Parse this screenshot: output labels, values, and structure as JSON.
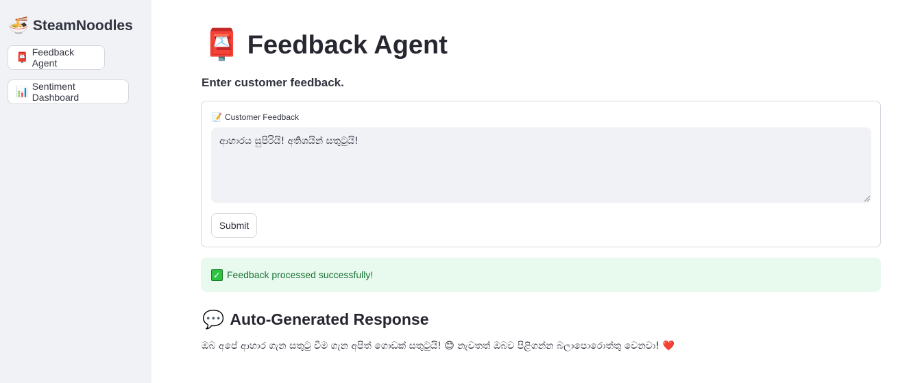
{
  "sidebar": {
    "brand": {
      "icon": "🍜",
      "name": "SteamNoodles"
    },
    "items": [
      {
        "icon": "📮",
        "label": "Feedback Agent"
      },
      {
        "icon": "📊",
        "label": "Sentiment Dashboard"
      }
    ]
  },
  "main": {
    "title": {
      "icon": "📮",
      "text": "Feedback Agent"
    },
    "subtitle": "Enter customer feedback.",
    "form": {
      "field_icon": "📝",
      "field_label": "Customer Feedback",
      "feedback_value": "ආහාරය සුපිරියි! අතිශයින් සතුටුයි!",
      "submit_label": "Submit"
    },
    "success": {
      "icon": "✓",
      "message": "Feedback processed successfully!"
    },
    "response": {
      "icon": "💬",
      "heading": "Auto-Generated Response",
      "text": "ඔබ අපේ ආහාර ගැන සතුටු වීම ගැන අපිත් ගොඩක් සතුටුයි! 😊 නැවතත් ඔබව පිළිගන්න බලාපොරොත්තු වෙනවා! ❤️"
    }
  },
  "colors": {
    "sidebar_bg": "#f0f2f6",
    "success_bg": "#e8f9ee",
    "success_text": "#177233"
  }
}
